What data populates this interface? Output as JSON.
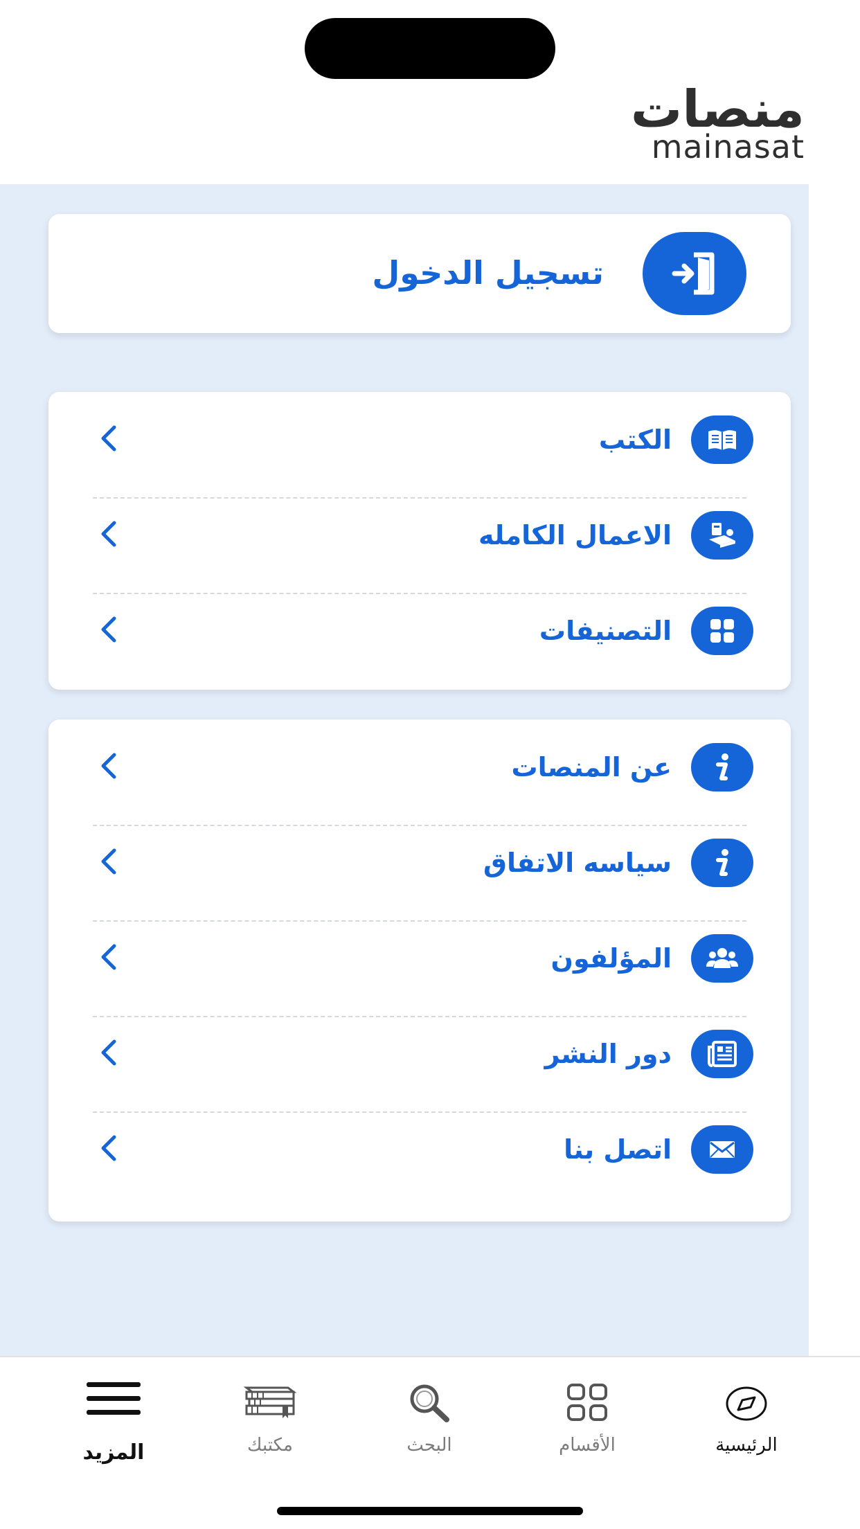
{
  "brand": {
    "name_ar": "منصات",
    "name_en": "mainasat"
  },
  "login": {
    "label": "تسجيل الدخول",
    "icon": "login-icon"
  },
  "main_menu": [
    {
      "label": "الكتب",
      "icon": "book-icon"
    },
    {
      "label": "الاعمال الكامله",
      "icon": "complete-works-icon"
    },
    {
      "label": "التصنيفات",
      "icon": "categories-grid-icon"
    }
  ],
  "info_menu": [
    {
      "label": "عن المنصات",
      "icon": "info-icon"
    },
    {
      "label": "سياسه الاتفاق",
      "icon": "info-icon"
    },
    {
      "label": "المؤلفون",
      "icon": "authors-group-icon"
    },
    {
      "label": "دور النشر",
      "icon": "publishers-newspaper-icon"
    },
    {
      "label": "اتصل بنا",
      "icon": "envelope-icon"
    }
  ],
  "bottom_nav": [
    {
      "label": "الرئيسية",
      "icon": "compass-icon"
    },
    {
      "label": "الأقسام",
      "icon": "sections-grid-icon"
    },
    {
      "label": "البحث",
      "icon": "search-icon"
    },
    {
      "label": "مكتبك",
      "icon": "library-books-icon"
    },
    {
      "label": "المزيد",
      "icon": "hamburger-menu-icon",
      "active": true
    }
  ],
  "colors": {
    "accent": "#1565d8",
    "panel_bg": "#e3ecf9",
    "text_dark": "#2f2f2f",
    "tab_inactive": "#7b7b7b"
  }
}
